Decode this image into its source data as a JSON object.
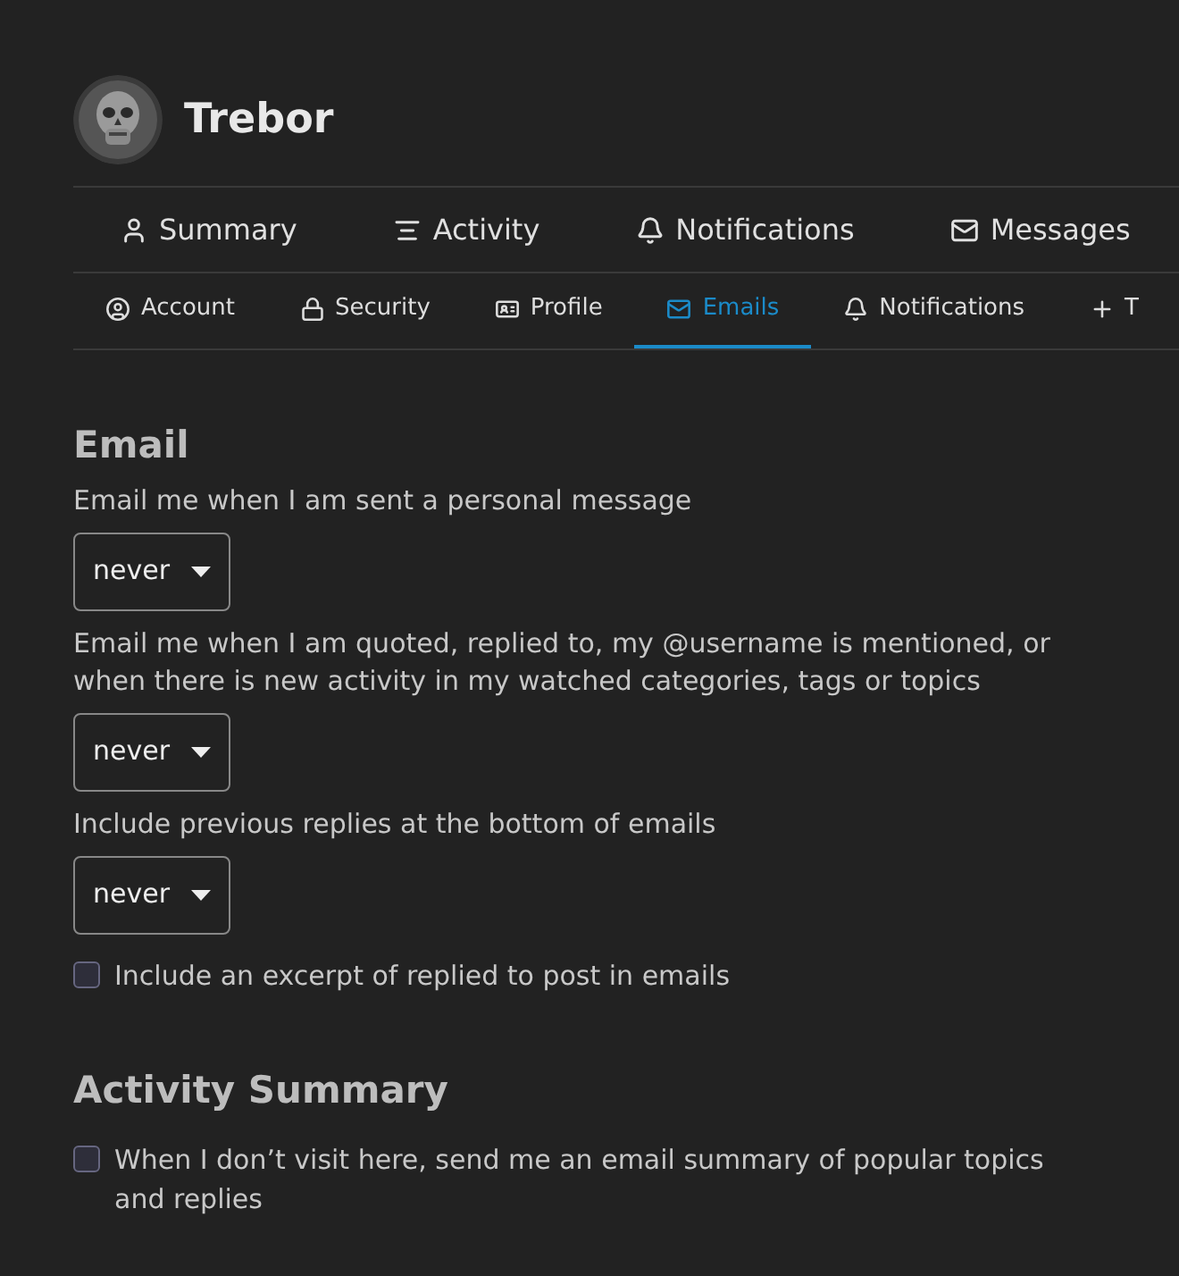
{
  "user": {
    "name": "Trebor"
  },
  "nav": [
    {
      "label": "Summary",
      "selected": false
    },
    {
      "label": "Activity",
      "selected": false
    },
    {
      "label": "Notifications",
      "selected": false
    },
    {
      "label": "Messages",
      "selected": false
    }
  ],
  "tabs": [
    {
      "label": "Account",
      "selected": false
    },
    {
      "label": "Security",
      "selected": false
    },
    {
      "label": "Profile",
      "selected": false
    },
    {
      "label": "Emails",
      "selected": true
    },
    {
      "label": "Notifications",
      "selected": false
    },
    {
      "label": "T",
      "selected": false
    }
  ],
  "sections": [
    {
      "title": "Email",
      "fields": [
        {
          "kind": "select",
          "label": "Email me when I am sent a personal message",
          "value": "never"
        },
        {
          "kind": "select",
          "label": "Email me when I am quoted, replied to, my @username is mentioned, or when there is new activity in my watched categories, tags or topics",
          "value": "never"
        },
        {
          "kind": "select",
          "label": "Include previous replies at the bottom of emails",
          "value": "never"
        },
        {
          "kind": "checkbox",
          "label": "Include an excerpt of replied to post in emails",
          "checked": false
        }
      ]
    },
    {
      "title": "Activity Summary",
      "fields": [
        {
          "kind": "checkbox",
          "label": "When I don’t visit here, send me an email summary of popular topics and replies",
          "checked": false
        }
      ]
    }
  ]
}
